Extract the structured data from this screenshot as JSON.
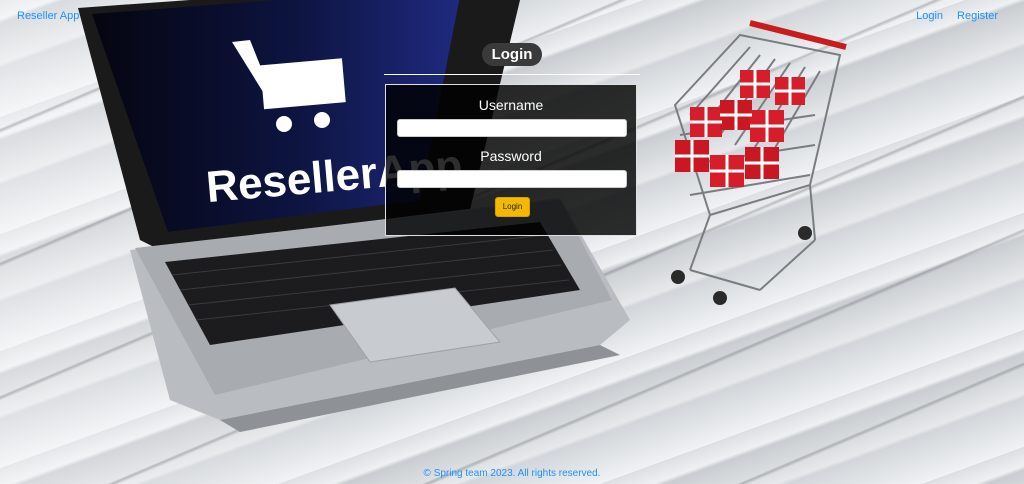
{
  "nav": {
    "brand": "Reseller App",
    "links": [
      {
        "label": "Login"
      },
      {
        "label": "Register"
      }
    ]
  },
  "hero": {
    "laptop_screen_text": "ResellerApp"
  },
  "login": {
    "title": "Login",
    "username_label": "Username",
    "username_value": "",
    "password_label": "Password",
    "password_value": "",
    "submit_label": "Login"
  },
  "footer": {
    "text": "© Spring team 2023. All rights reserved."
  },
  "colors": {
    "link": "#1e90ff",
    "button": "#f5b800",
    "form_bg": "#000000"
  }
}
